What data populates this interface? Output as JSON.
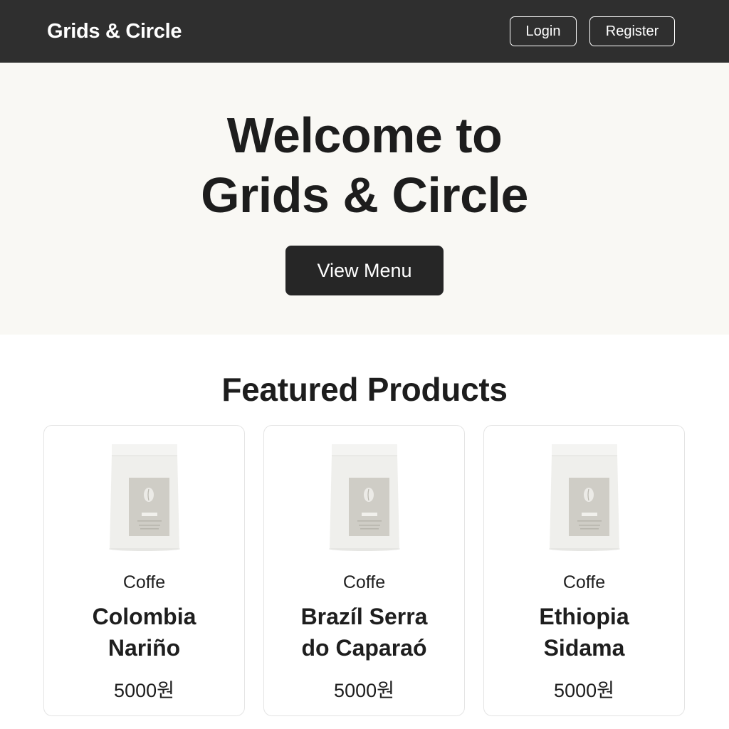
{
  "header": {
    "brand": "Grids & Circle",
    "login_label": "Login",
    "register_label": "Register"
  },
  "hero": {
    "title_line1": "Welcome to",
    "title_line2": "Grids & Circle",
    "cta_label": "View Menu"
  },
  "featured": {
    "title": "Featured Products",
    "products": [
      {
        "category": "Coffe",
        "name_line1": "Colombia",
        "name_line2": "Nariño",
        "price": "5000원"
      },
      {
        "category": "Coffe",
        "name_line1": "Brazíl Serra",
        "name_line2": "do Caparaó",
        "price": "5000원"
      },
      {
        "category": "Coffe",
        "name_line1": "Ethiopia",
        "name_line2": "Sidama",
        "price": "5000원"
      }
    ]
  },
  "icons": {
    "product_image": "coffee-bag-icon"
  },
  "colors": {
    "header_bg": "#2f2f2f",
    "hero_bg": "#f9f8f4",
    "cta_bg": "#262626",
    "text": "#1d1d1d"
  }
}
